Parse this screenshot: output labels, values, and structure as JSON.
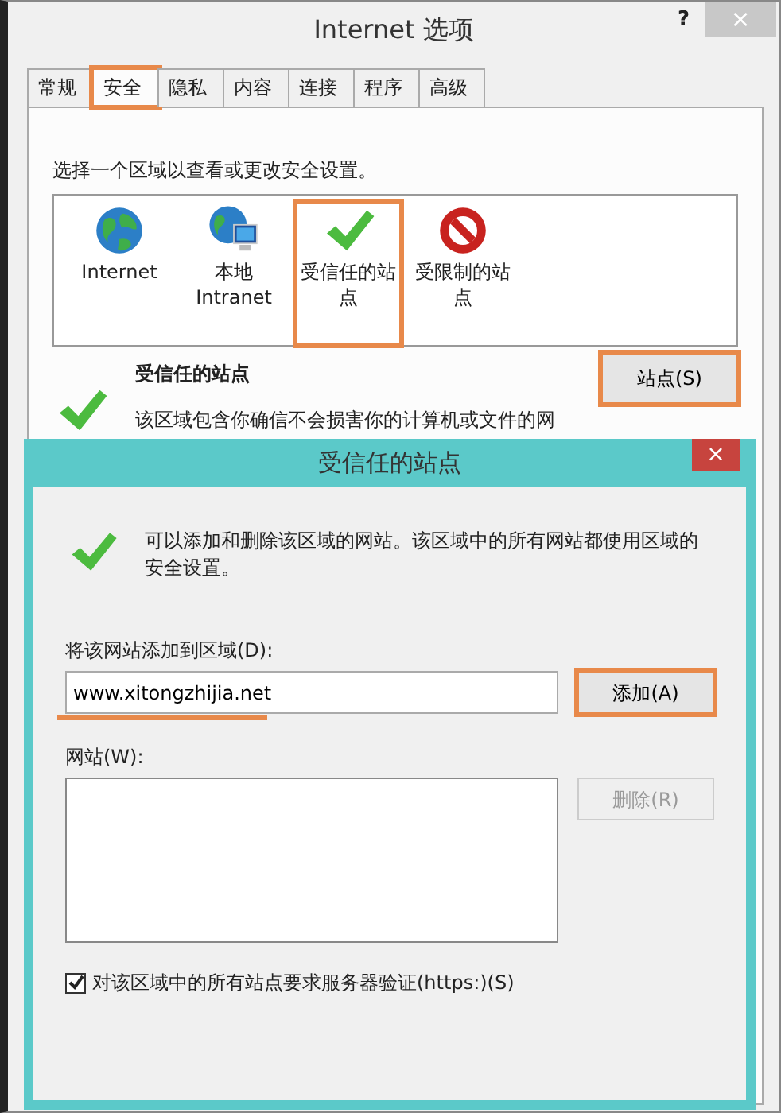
{
  "window": {
    "title": "Internet 选项",
    "help": "?",
    "close": "×"
  },
  "tabs": [
    {
      "label": "常规",
      "selected": false,
      "highlighted": false
    },
    {
      "label": "安全",
      "selected": true,
      "highlighted": true
    },
    {
      "label": "隐私",
      "selected": false,
      "highlighted": false
    },
    {
      "label": "内容",
      "selected": false,
      "highlighted": false
    },
    {
      "label": "连接",
      "selected": false,
      "highlighted": false
    },
    {
      "label": "程序",
      "selected": false,
      "highlighted": false
    },
    {
      "label": "高级",
      "selected": false,
      "highlighted": false
    }
  ],
  "instruction": "选择一个区域以查看或更改安全设置。",
  "zones": [
    {
      "kind": "globe",
      "label": "Internet",
      "highlighted": false
    },
    {
      "kind": "network",
      "label": "本地 Intranet",
      "highlighted": false
    },
    {
      "kind": "check",
      "label": "受信任的站点",
      "highlighted": true
    },
    {
      "kind": "blocked",
      "label": "受限制的站点",
      "highlighted": false
    }
  ],
  "zone_info": {
    "title": "受信任的站点",
    "description": "该区域包含你确信不会损害你的计算机或文件的网",
    "button": {
      "label": "站点(S)",
      "highlighted": true
    }
  },
  "dialog": {
    "title": "受信任的站点",
    "close": "×",
    "message": "可以添加和删除该区域的网站。该区域中的所有网站都使用区域的安全设置。",
    "add_label": "将该网站添加到区域(D):",
    "add_field": {
      "value": "www.xitongzhijia.net",
      "underlined": true
    },
    "add_button": {
      "label": "添加(A)",
      "highlighted": true
    },
    "list_label": "网站(W):",
    "remove_button": {
      "label": "删除(R)",
      "disabled": true
    },
    "https_check": {
      "label": "对该区域中的所有站点要求服务器验证(https:)(S)",
      "checked": true
    }
  }
}
